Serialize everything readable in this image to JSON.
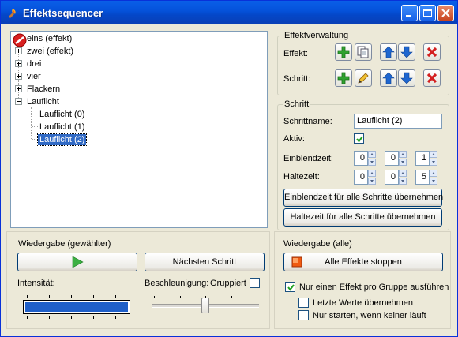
{
  "window": {
    "title": "Effektsequencer",
    "icon": "app-torch-icon"
  },
  "tree": {
    "items": [
      {
        "label": "eins (effekt)",
        "level": 0,
        "expander": "plus"
      },
      {
        "label": "zwei (effekt)",
        "level": 0,
        "expander": "plus"
      },
      {
        "label": "drei",
        "level": 0,
        "expander": "plus"
      },
      {
        "label": "vier",
        "level": 0,
        "expander": "plus"
      },
      {
        "label": "Flackern",
        "level": 0,
        "expander": "plus"
      },
      {
        "label": "Lauflicht",
        "level": 0,
        "expander": "minus"
      },
      {
        "label": "Lauflicht (0)",
        "level": 1
      },
      {
        "label": "Lauflicht (1)",
        "level": 1
      },
      {
        "label": "Lauflicht (2)",
        "level": 1,
        "selected": true
      }
    ]
  },
  "effektverwaltung": {
    "legend": "Effektverwaltung",
    "effekt_label": "Effekt:",
    "schritt_label": "Schritt:"
  },
  "schritt": {
    "legend": "Schritt",
    "name_label": "Schrittname:",
    "name_value": "Lauflicht (2)",
    "aktiv_label": "Aktiv:",
    "aktiv_checked": true,
    "einblend_label": "Einblendzeit:",
    "einblend_values": [
      "0",
      "0",
      "1"
    ],
    "halte_label": "Haltezeit:",
    "halte_values": [
      "0",
      "0",
      "5"
    ],
    "btn_einblend_all": "Einblendzeit für alle Schritte übernehmen",
    "btn_halte_all": "Haltezeit für alle Schritte übernehmen"
  },
  "wiedergabe": {
    "legend": "Wiedergabe (gewählter)",
    "next_step": "Nächsten Schritt",
    "intensity_label": "Intensität:",
    "intensity_value": 1.0,
    "accel_label": "Beschleunigung:",
    "grouped_label": "Gruppiert",
    "grouped_checked": false,
    "accel_value": 0.5
  },
  "wiedergabe_alle": {
    "legend": "Wiedergabe (alle)",
    "stop_all": "Alle Effekte stoppen",
    "opt1": "Nur einen Effekt pro Gruppe ausführen",
    "opt1_checked": true,
    "opt2": "Letzte Werte übernehmen",
    "opt2_checked": false,
    "opt3": "Nur starten, wenn keiner läuft",
    "opt3_checked": false
  },
  "colors": {
    "titlebar": "#0553dc",
    "selection": "#316ac5",
    "add_green": "#2fa12f",
    "arrow_blue": "#1e66d0",
    "delete_red": "#d32020",
    "intensity_fill": "#1f5fc8"
  }
}
